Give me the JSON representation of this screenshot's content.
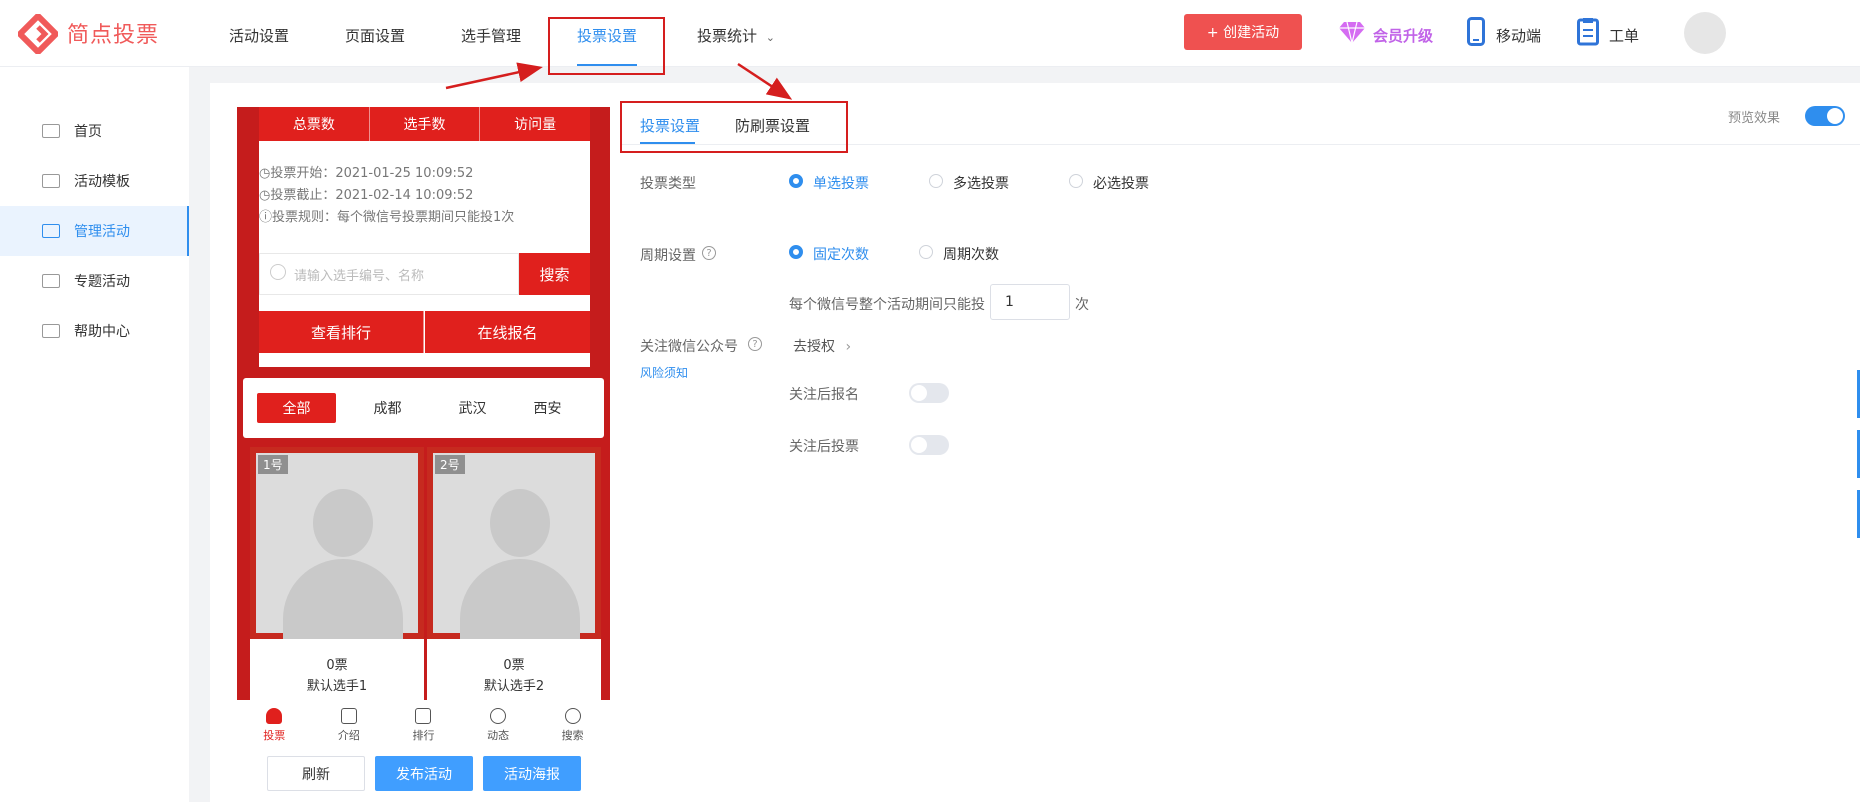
{
  "app": {
    "logo_text": "简点投票"
  },
  "nav": {
    "items": [
      "活动设置",
      "页面设置",
      "选手管理",
      "投票设置",
      "投票统计"
    ],
    "create_label": "+ 创建活动",
    "vip_label": "会员升级",
    "mobile_label": "移动端",
    "ticket_label": "工单"
  },
  "sidebar": {
    "items": [
      {
        "label": "首页"
      },
      {
        "label": "活动模板"
      },
      {
        "label": "管理活动"
      },
      {
        "label": "专题活动"
      },
      {
        "label": "帮助中心"
      }
    ]
  },
  "preview": {
    "stats": [
      "总票数",
      "选手数",
      "访问量"
    ],
    "vote_start": "投票开始：2021-01-25 10:09:52",
    "vote_end": "投票截止：2021-02-14 10:09:52",
    "vote_rule": "投票规则：每个微信号投票期间只能投1次",
    "search_placeholder": "请输入选手编号、名称",
    "search_btn": "搜索",
    "rank_btn": "查看排行",
    "signup_btn": "在线报名",
    "cities": [
      "全部",
      "成都",
      "武汉",
      "西安"
    ],
    "candidates": [
      {
        "no": "1号",
        "votes": "0票",
        "name": "默认选手1"
      },
      {
        "no": "2号",
        "votes": "0票",
        "name": "默认选手2"
      }
    ],
    "tabbar": [
      "投票",
      "介绍",
      "排行",
      "动态",
      "搜索"
    ]
  },
  "buttons": {
    "refresh": "刷新",
    "publish": "发布活动",
    "poster": "活动海报"
  },
  "settings": {
    "tabs": [
      "投票设置",
      "防刷票设置"
    ],
    "preview_label": "预览效果",
    "preview_on": true,
    "vote_type_label": "投票类型",
    "vote_types": [
      "单选投票",
      "多选投票",
      "必选投票"
    ],
    "vote_type_selected": 0,
    "period_label": "周期设置",
    "period_types": [
      "固定次数",
      "周期次数"
    ],
    "period_selected": 0,
    "per_user_text": "每个微信号整个活动期间只能投",
    "per_user_value": "1",
    "per_user_unit": "次",
    "follow_label": "关注微信公众号",
    "authorize_link": "去授权",
    "risk_link": "风险须知",
    "follow_signup_label": "关注后报名",
    "follow_vote_label": "关注后投票"
  }
}
